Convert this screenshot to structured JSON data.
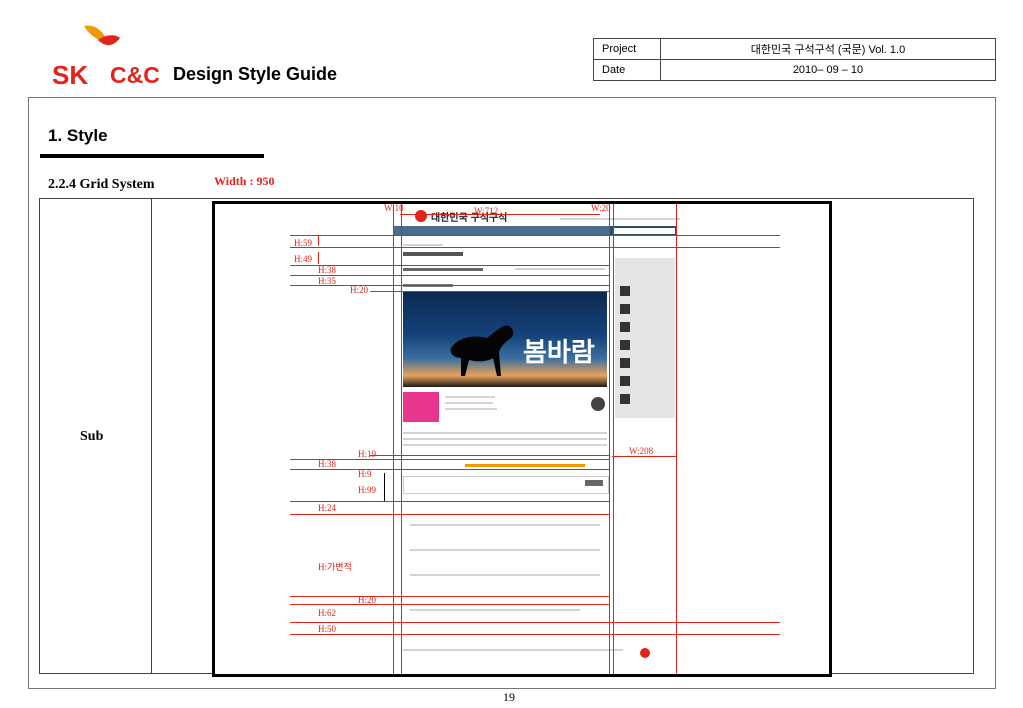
{
  "header": {
    "logo_sk": "SK",
    "logo_cc": "C&C",
    "doc_title": "Design Style Guide"
  },
  "meta": {
    "project_label": "Project",
    "project_value": "대한민국 구석구석 (국문)  Vol. 1.0",
    "date_label": "Date",
    "date_value": "2010– 09 – 10"
  },
  "section": {
    "title": "1. Style",
    "subsection": "2.2.4 Grid System",
    "width_label": "Width : 950"
  },
  "grid": {
    "row_label": "Sub"
  },
  "annotations": {
    "w10": "W:10",
    "w712": "W:712",
    "w20": "W:20",
    "w208": "W:208",
    "h59": "H:59",
    "h49": "H:49",
    "h38a": "H:38",
    "h35": "H:35",
    "h20a": "H:20",
    "h19": "H:19",
    "h38b": "H:38",
    "h9": "H:9",
    "h99": "H:99",
    "h24": "H:24",
    "hvar": "H:가변적",
    "h20b": "H:20",
    "h62": "H:62",
    "h50": "H:50"
  },
  "site": {
    "title": "대한민국 구석구석"
  },
  "hero": {
    "overlay_text": "봄바람"
  },
  "footer": {
    "page_number": "19"
  },
  "colors": {
    "brand_red": "#e2231a",
    "brand_orange": "#f39800",
    "nav_blue": "#4a6d8c",
    "pink_box": "#e8368f"
  }
}
